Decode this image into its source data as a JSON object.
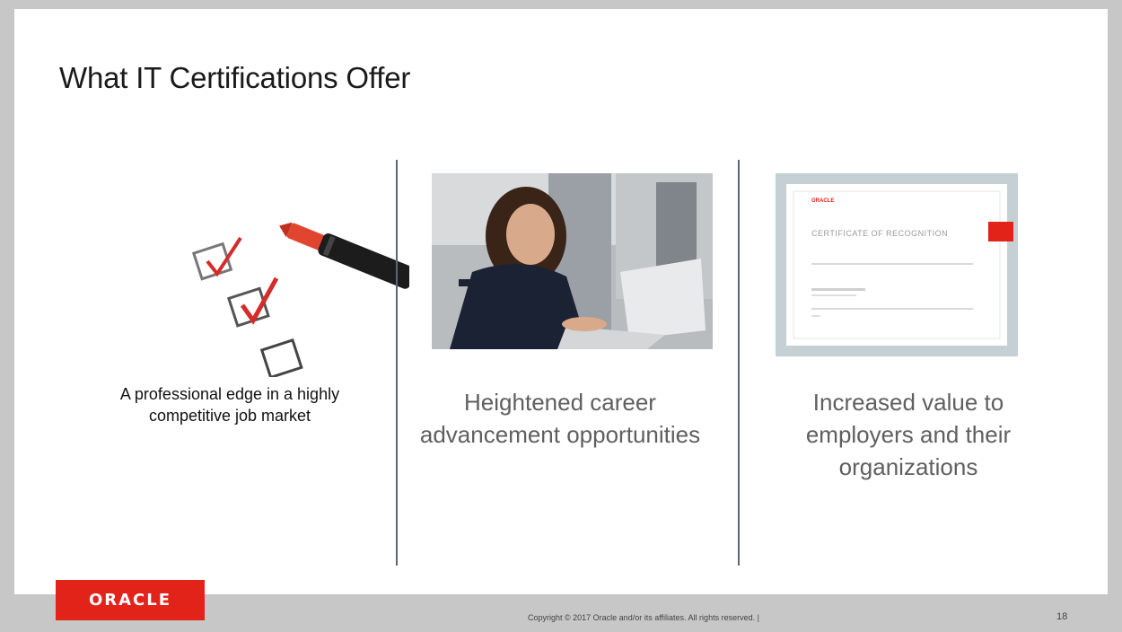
{
  "slide": {
    "title": "What IT Certifications Offer"
  },
  "columns": [
    {
      "caption": "A professional edge in a highly competitive job market",
      "image_icon": "checklist-marker-icon"
    },
    {
      "caption": "Heightened career advancement opportunities",
      "image_icon": "woman-laptop-photo"
    },
    {
      "caption": "Increased value to employers and their organizations",
      "image_icon": "certificate-image"
    }
  ],
  "certificate": {
    "brand": "ORACLE",
    "heading": "CERTIFICATE OF RECOGNITION"
  },
  "footer": {
    "logo_text": "ORACLE",
    "copyright": "Copyright © 2017 Oracle and/or its affiliates. All rights reserved.  |",
    "page_number": "18"
  },
  "colors": {
    "brand_red": "#e2231a",
    "divider": "#5a6778",
    "background": "#c7c7c7"
  }
}
